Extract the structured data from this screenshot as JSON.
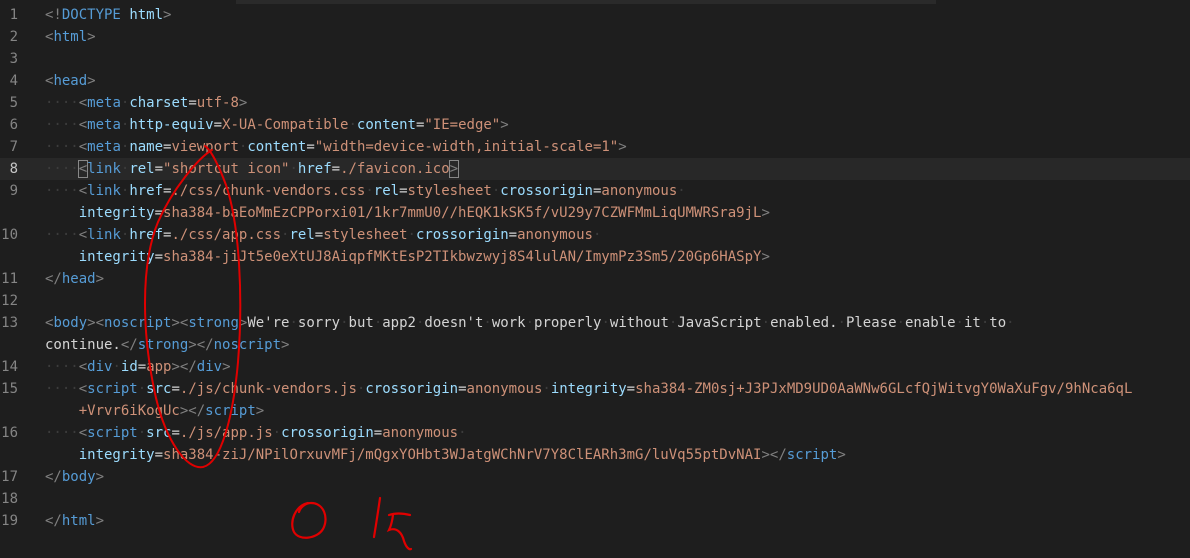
{
  "editor": {
    "line_numbers": [
      "1",
      "2",
      "3",
      "4",
      "5",
      "6",
      "7",
      "8",
      "9",
      "",
      "10",
      "",
      "11",
      "12",
      "13",
      "",
      "14",
      "15",
      "",
      "16",
      "",
      "17",
      "18",
      "19"
    ],
    "rows": [
      [
        [
          "t",
          "<!"
        ],
        [
          "tn",
          "DOCTYPE"
        ],
        [
          "tx",
          " "
        ],
        [
          "an",
          "html"
        ],
        [
          "t",
          ">"
        ]
      ],
      [
        [
          "t",
          "<"
        ],
        [
          "tn",
          "html"
        ],
        [
          "t",
          ">"
        ]
      ],
      [],
      [
        [
          "t",
          "<"
        ],
        [
          "tn",
          "head"
        ],
        [
          "t",
          ">"
        ]
      ],
      [
        [
          "dot",
          "····"
        ],
        [
          "t",
          "<"
        ],
        [
          "tn",
          "meta"
        ],
        [
          "dot",
          "·"
        ],
        [
          "an",
          "charset"
        ],
        [
          "tx",
          "="
        ],
        [
          "av",
          "utf-8"
        ],
        [
          "t",
          ">"
        ]
      ],
      [
        [
          "dot",
          "····"
        ],
        [
          "t",
          "<"
        ],
        [
          "tn",
          "meta"
        ],
        [
          "dot",
          "·"
        ],
        [
          "an",
          "http-equiv"
        ],
        [
          "tx",
          "="
        ],
        [
          "av",
          "X-UA-Compatible"
        ],
        [
          "dot",
          "·"
        ],
        [
          "an",
          "content"
        ],
        [
          "tx",
          "="
        ],
        [
          "av",
          "\"IE=edge\""
        ],
        [
          "t",
          ">"
        ]
      ],
      [
        [
          "dot",
          "····"
        ],
        [
          "t",
          "<"
        ],
        [
          "tn",
          "meta"
        ],
        [
          "dot",
          "·"
        ],
        [
          "an",
          "name"
        ],
        [
          "tx",
          "="
        ],
        [
          "av",
          "viewport"
        ],
        [
          "dot",
          "·"
        ],
        [
          "an",
          "content"
        ],
        [
          "tx",
          "="
        ],
        [
          "av",
          "\"width=device-width,initial-scale=1\""
        ],
        [
          "t",
          ">"
        ]
      ],
      [
        [
          "dot",
          "····"
        ],
        [
          "tb",
          "<"
        ],
        [
          "tn",
          "link"
        ],
        [
          "dot",
          "·"
        ],
        [
          "an",
          "rel"
        ],
        [
          "tx",
          "="
        ],
        [
          "av",
          "\"shortcut icon\""
        ],
        [
          "dot",
          "·"
        ],
        [
          "an",
          "href"
        ],
        [
          "tx",
          "="
        ],
        [
          "av",
          "./favicon.ico"
        ],
        [
          "tb",
          ">"
        ]
      ],
      [
        [
          "dot",
          "····"
        ],
        [
          "t",
          "<"
        ],
        [
          "tn",
          "link"
        ],
        [
          "dot",
          "·"
        ],
        [
          "an",
          "href"
        ],
        [
          "tx",
          "="
        ],
        [
          "av",
          "./css/chunk-vendors.css"
        ],
        [
          "dot",
          "·"
        ],
        [
          "an",
          "rel"
        ],
        [
          "tx",
          "="
        ],
        [
          "av",
          "stylesheet"
        ],
        [
          "dot",
          "·"
        ],
        [
          "an",
          "crossorigin"
        ],
        [
          "tx",
          "="
        ],
        [
          "av",
          "anonymous"
        ],
        [
          "dot",
          "·"
        ]
      ],
      [
        [
          "tx",
          "    "
        ],
        [
          "an",
          "integrity"
        ],
        [
          "tx",
          "="
        ],
        [
          "av",
          "sha384-baEoMmEzCPPorxi01/1kr7mmU0//hEQK1kSK5f/vU29y7CZWFMmLiqUMWRSra9jL"
        ],
        [
          "t",
          ">"
        ]
      ],
      [
        [
          "dot",
          "····"
        ],
        [
          "t",
          "<"
        ],
        [
          "tn",
          "link"
        ],
        [
          "dot",
          "·"
        ],
        [
          "an",
          "href"
        ],
        [
          "tx",
          "="
        ],
        [
          "av",
          "./css/app.css"
        ],
        [
          "dot",
          "·"
        ],
        [
          "an",
          "rel"
        ],
        [
          "tx",
          "="
        ],
        [
          "av",
          "stylesheet"
        ],
        [
          "dot",
          "·"
        ],
        [
          "an",
          "crossorigin"
        ],
        [
          "tx",
          "="
        ],
        [
          "av",
          "anonymous"
        ],
        [
          "dot",
          "·"
        ]
      ],
      [
        [
          "tx",
          "    "
        ],
        [
          "an",
          "integrity"
        ],
        [
          "tx",
          "="
        ],
        [
          "av",
          "sha384-jiJt5e0eXtUJ8AiqpfMKtEsP2TIkbwzwyj8S4lulAN/ImymPz3Sm5/20Gp6HASpY"
        ],
        [
          "t",
          ">"
        ]
      ],
      [
        [
          "t",
          "</"
        ],
        [
          "tn",
          "head"
        ],
        [
          "t",
          ">"
        ]
      ],
      [],
      [
        [
          "t",
          "<"
        ],
        [
          "tn",
          "body"
        ],
        [
          "t",
          "><"
        ],
        [
          "tn",
          "noscript"
        ],
        [
          "t",
          "><"
        ],
        [
          "tn",
          "strong"
        ],
        [
          "t",
          ">"
        ],
        [
          "tx",
          "We're"
        ],
        [
          "dot",
          "·"
        ],
        [
          "tx",
          "sorry"
        ],
        [
          "dot",
          "·"
        ],
        [
          "tx",
          "but"
        ],
        [
          "dot",
          "·"
        ],
        [
          "tx",
          "app2"
        ],
        [
          "dot",
          "·"
        ],
        [
          "tx",
          "doesn't"
        ],
        [
          "dot",
          "·"
        ],
        [
          "tx",
          "work"
        ],
        [
          "dot",
          "·"
        ],
        [
          "tx",
          "properly"
        ],
        [
          "dot",
          "·"
        ],
        [
          "tx",
          "without"
        ],
        [
          "dot",
          "·"
        ],
        [
          "tx",
          "JavaScript"
        ],
        [
          "dot",
          "·"
        ],
        [
          "tx",
          "enabled."
        ],
        [
          "dot",
          "·"
        ],
        [
          "tx",
          "Please"
        ],
        [
          "dot",
          "·"
        ],
        [
          "tx",
          "enable"
        ],
        [
          "dot",
          "·"
        ],
        [
          "tx",
          "it"
        ],
        [
          "dot",
          "·"
        ],
        [
          "tx",
          "to"
        ],
        [
          "dot",
          "·"
        ]
      ],
      [
        [
          "tx",
          "continue."
        ],
        [
          "t",
          "</"
        ],
        [
          "tn",
          "strong"
        ],
        [
          "t",
          "></"
        ],
        [
          "tn",
          "noscript"
        ],
        [
          "t",
          ">"
        ]
      ],
      [
        [
          "dot",
          "····"
        ],
        [
          "t",
          "<"
        ],
        [
          "tn",
          "div"
        ],
        [
          "dot",
          "·"
        ],
        [
          "an",
          "id"
        ],
        [
          "tx",
          "="
        ],
        [
          "av",
          "app"
        ],
        [
          "t",
          "></"
        ],
        [
          "tn",
          "div"
        ],
        [
          "t",
          ">"
        ]
      ],
      [
        [
          "dot",
          "····"
        ],
        [
          "t",
          "<"
        ],
        [
          "tn",
          "script"
        ],
        [
          "dot",
          "·"
        ],
        [
          "an",
          "src"
        ],
        [
          "tx",
          "="
        ],
        [
          "av",
          "./js/chunk-vendors.js"
        ],
        [
          "dot",
          "·"
        ],
        [
          "an",
          "crossorigin"
        ],
        [
          "tx",
          "="
        ],
        [
          "av",
          "anonymous"
        ],
        [
          "dot",
          "·"
        ],
        [
          "an",
          "integrity"
        ],
        [
          "tx",
          "="
        ],
        [
          "av",
          "sha384-ZM0sj+J3PJxMD9UD0AaWNw6GLcfQjWitvgY0WaXuFgv/9hNca6qL"
        ]
      ],
      [
        [
          "tx",
          "    "
        ],
        [
          "av",
          "+Vrvr6iKogUc"
        ],
        [
          "t",
          "></"
        ],
        [
          "tn",
          "script"
        ],
        [
          "t",
          ">"
        ]
      ],
      [
        [
          "dot",
          "····"
        ],
        [
          "t",
          "<"
        ],
        [
          "tn",
          "script"
        ],
        [
          "dot",
          "·"
        ],
        [
          "an",
          "src"
        ],
        [
          "tx",
          "="
        ],
        [
          "av",
          "./js/app.js"
        ],
        [
          "dot",
          "·"
        ],
        [
          "an",
          "crossorigin"
        ],
        [
          "tx",
          "="
        ],
        [
          "av",
          "anonymous"
        ],
        [
          "dot",
          "·"
        ]
      ],
      [
        [
          "tx",
          "    "
        ],
        [
          "an",
          "integrity"
        ],
        [
          "tx",
          "="
        ],
        [
          "av",
          "sha384-ziJ/NPilOrxuvMFj/mQgxYOHbt3WJatgWChNrV7Y8ClEARh3mG/luVq55ptDvNAI"
        ],
        [
          "t",
          "></"
        ],
        [
          "tn",
          "script"
        ],
        [
          "t",
          ">"
        ]
      ],
      [
        [
          "t",
          "</"
        ],
        [
          "tn",
          "body"
        ],
        [
          "t",
          ">"
        ]
      ],
      [],
      [
        [
          "t",
          "</"
        ],
        [
          "tn",
          "html"
        ],
        [
          "t",
          ">"
        ]
      ]
    ],
    "active_line": "8",
    "colors": {
      "background": "#1e1e1e",
      "tag_bracket": "#808080",
      "tag_name": "#569cd6",
      "attr_name": "#9cdcfe",
      "attr_value": "#ce9178",
      "text": "#d4d4d4",
      "annotation": "#e00000"
    }
  },
  "annotation": {
    "handwritten_text": "0 15"
  }
}
